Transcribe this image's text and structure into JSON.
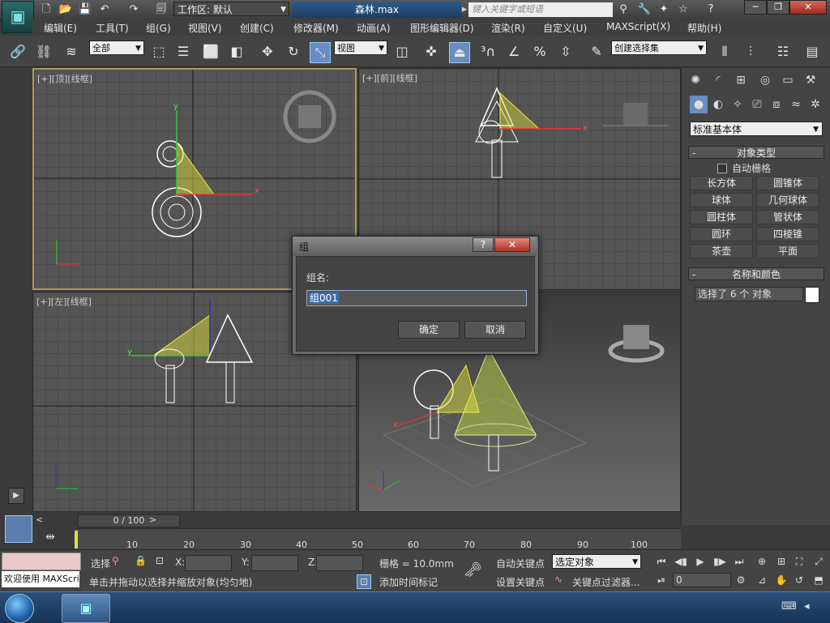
{
  "window": {
    "workspace": "工作区: 默认",
    "doc_title": "森林.max",
    "search_placeholder": "键入关键字或短语",
    "min_label": "─",
    "max_label": "❐",
    "close_label": "✕"
  },
  "menu": [
    "编辑(E)",
    "工具(T)",
    "组(G)",
    "视图(V)",
    "创建(C)",
    "修改器(M)",
    "动画(A)",
    "图形编辑器(D)",
    "渲染(R)",
    "自定义(U)",
    "MAXScript(X)",
    "帮助(H)"
  ],
  "toolbar": {
    "selection_filter": "全部",
    "ref_coord": "视图",
    "named_selection": "创建选择集"
  },
  "viewports": {
    "top": "[+][顶][线框]",
    "front": "[+][前][线框]",
    "left": "[+][左][线框]",
    "persp": ""
  },
  "cmdpanel": {
    "category": "标准基本体",
    "object_type_title": "对象类型",
    "autogrid": "自动栅格",
    "objects": [
      "长方体",
      "圆锥体",
      "球体",
      "几何球体",
      "圆柱体",
      "管状体",
      "圆环",
      "四棱锥",
      "茶壶",
      "平面"
    ],
    "name_color_title": "名称和颜色",
    "name_value": "选择了 6 个 对象",
    "swatch_color": "#ffffff"
  },
  "time": {
    "frame_display": "0 / 100",
    "ticks": [
      "10",
      "20",
      "30",
      "40",
      "50",
      "60",
      "70",
      "80",
      "90",
      "100"
    ]
  },
  "status": {
    "welcome": "欢迎使用 MAXScri",
    "select_label": "选择",
    "x_label": "X:",
    "y_label": "Y:",
    "z_label": "Z:",
    "grid": "栅格 = 10.0mm",
    "auto_key": "自动关键点",
    "set_key": "设置关键点",
    "filter_value": "选定对象",
    "key_filters": "关键点过滤器...",
    "add_time_tag": "添加时间标记",
    "prompt": "单击并拖动以选择并缩放对象(均匀地)",
    "frame_value": "0"
  },
  "dialog": {
    "title": "组",
    "help": "?",
    "close": "✕",
    "group_name_label": "组名:",
    "group_name_value": "组001",
    "ok": "确定",
    "cancel": "取消"
  }
}
